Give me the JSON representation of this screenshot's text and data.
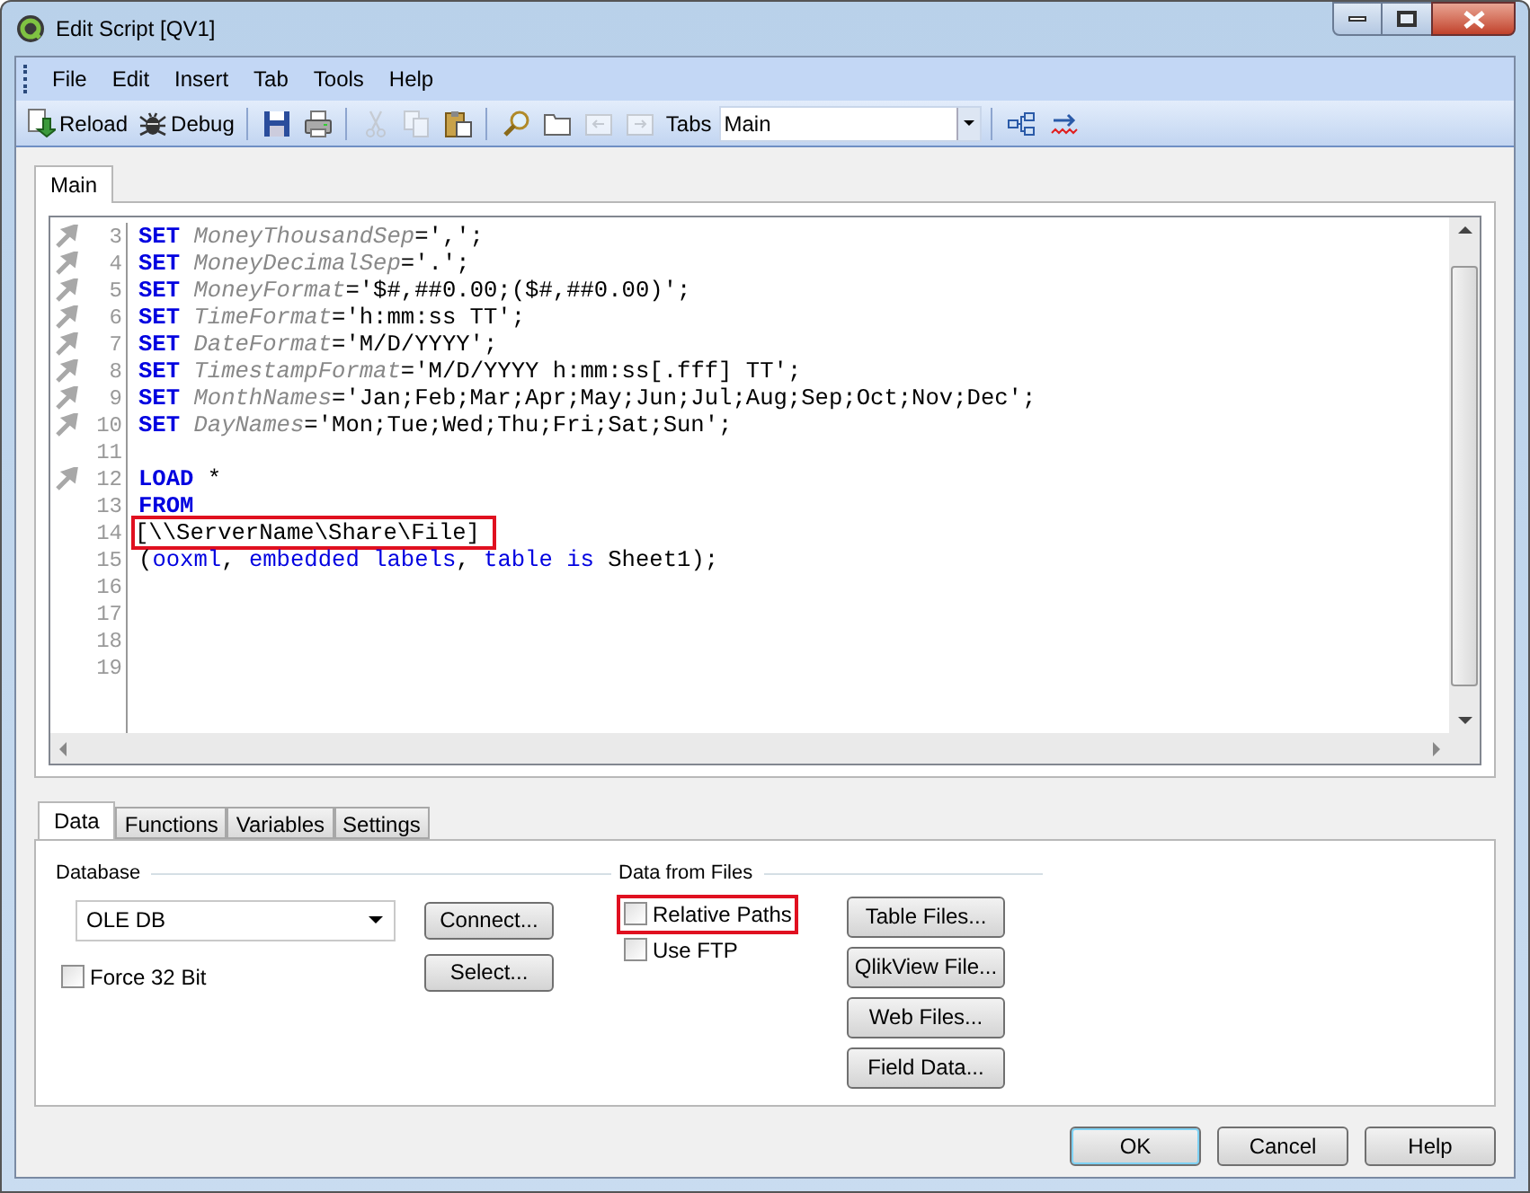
{
  "window": {
    "title": "Edit Script [QV1]"
  },
  "menu": [
    "File",
    "Edit",
    "Insert",
    "Tab",
    "Tools",
    "Help"
  ],
  "toolbar": {
    "buttons": [
      {
        "label": "Reload"
      },
      {
        "label": "Debug"
      }
    ],
    "icon_tools": [
      {
        "disabled": false
      },
      {
        "disabled": false
      },
      {
        "disabled": true
      },
      {
        "disabled": true
      },
      {
        "disabled": false
      },
      {
        "disabled": false
      },
      {
        "disabled": false
      },
      {
        "disabled": true
      },
      {
        "disabled": true
      }
    ],
    "tabs_label": "Tabs",
    "tabs_value": "Main"
  },
  "script_tabs": [
    {
      "label": "Main",
      "selected": true
    }
  ],
  "editor": {
    "lines": [
      {
        "number": "3",
        "marker": true,
        "highlighted": false,
        "tokens": [
          {
            "kind": "keyword",
            "text": "SET "
          },
          {
            "kind": "variable",
            "text": "MoneyThousandSep"
          },
          {
            "kind": "plain",
            "text": "=',';"
          }
        ]
      },
      {
        "number": "4",
        "marker": true,
        "highlighted": false,
        "tokens": [
          {
            "kind": "keyword",
            "text": "SET "
          },
          {
            "kind": "variable",
            "text": "MoneyDecimalSep"
          },
          {
            "kind": "plain",
            "text": "='.';"
          }
        ]
      },
      {
        "number": "5",
        "marker": true,
        "highlighted": false,
        "tokens": [
          {
            "kind": "keyword",
            "text": "SET "
          },
          {
            "kind": "variable",
            "text": "MoneyFormat"
          },
          {
            "kind": "plain",
            "text": "='$#,##0.00;($#,##0.00)';"
          }
        ]
      },
      {
        "number": "6",
        "marker": true,
        "highlighted": false,
        "tokens": [
          {
            "kind": "keyword",
            "text": "SET "
          },
          {
            "kind": "variable",
            "text": "TimeFormat"
          },
          {
            "kind": "plain",
            "text": "='h:mm:ss TT';"
          }
        ]
      },
      {
        "number": "7",
        "marker": true,
        "highlighted": false,
        "tokens": [
          {
            "kind": "keyword",
            "text": "SET "
          },
          {
            "kind": "variable",
            "text": "DateFormat"
          },
          {
            "kind": "plain",
            "text": "='M/D/YYYY';"
          }
        ]
      },
      {
        "number": "8",
        "marker": true,
        "highlighted": false,
        "tokens": [
          {
            "kind": "keyword",
            "text": "SET "
          },
          {
            "kind": "variable",
            "text": "TimestampFormat"
          },
          {
            "kind": "plain",
            "text": "='M/D/YYYY h:mm:ss[.fff] TT';"
          }
        ]
      },
      {
        "number": "9",
        "marker": true,
        "highlighted": false,
        "tokens": [
          {
            "kind": "keyword",
            "text": "SET "
          },
          {
            "kind": "variable",
            "text": "MonthNames"
          },
          {
            "kind": "plain",
            "text": "='Jan;Feb;Mar;Apr;May;Jun;Jul;Aug;Sep;Oct;Nov;Dec';"
          }
        ]
      },
      {
        "number": "10",
        "marker": true,
        "highlighted": false,
        "tokens": [
          {
            "kind": "keyword",
            "text": "SET "
          },
          {
            "kind": "variable",
            "text": "DayNames"
          },
          {
            "kind": "plain",
            "text": "='Mon;Tue;Wed;Thu;Fri;Sat;Sun';"
          }
        ]
      },
      {
        "number": "11",
        "marker": false,
        "highlighted": false
      },
      {
        "number": "12",
        "marker": true,
        "highlighted": false,
        "tokens": [
          {
            "kind": "keyword",
            "text": "LOAD"
          },
          {
            "kind": "plain",
            "text": " *"
          }
        ]
      },
      {
        "number": "13",
        "marker": false,
        "highlighted": false,
        "tokens": [
          {
            "kind": "keyword",
            "text": "FROM"
          }
        ]
      },
      {
        "number": "14",
        "marker": false,
        "highlighted": true,
        "tokens": [
          {
            "kind": "plain",
            "text": "[\\\\ServerName\\Share\\File]"
          }
        ]
      },
      {
        "number": "15",
        "marker": false,
        "highlighted": false,
        "tokens": [
          {
            "kind": "plain",
            "text": "("
          },
          {
            "kind": "keyword",
            "text": "ooxml"
          },
          {
            "kind": "plain",
            "text": ", "
          },
          {
            "kind": "keyword",
            "text": "embedded labels"
          },
          {
            "kind": "plain",
            "text": ", "
          },
          {
            "kind": "keyword",
            "text": "table is"
          },
          {
            "kind": "plain",
            "text": " Sheet1);"
          }
        ]
      },
      {
        "number": "16",
        "marker": false,
        "highlighted": false
      },
      {
        "number": "17",
        "marker": false,
        "highlighted": false
      },
      {
        "number": "18",
        "marker": false,
        "highlighted": false
      },
      {
        "number": "19",
        "marker": false,
        "highlighted": false
      }
    ]
  },
  "panel_tabs": [
    {
      "label": "Data",
      "selected": true
    },
    {
      "label": "Functions",
      "selected": false
    },
    {
      "label": "Variables",
      "selected": false
    },
    {
      "label": "Settings",
      "selected": false
    }
  ],
  "database": {
    "title": "Database",
    "value": "OLE DB",
    "checkbox": {
      "label": "Force 32 Bit",
      "checked": false,
      "highlighted": false
    },
    "buttons": [
      "Connect...",
      "Select..."
    ]
  },
  "data_from_files": {
    "title": "Data from Files",
    "checkboxes": [
      {
        "label": "Relative Paths",
        "checked": false,
        "highlighted": true
      },
      {
        "label": "Use FTP",
        "checked": false,
        "highlighted": false
      }
    ],
    "buttons": [
      "Table Files...",
      "QlikView File...",
      "Web Files...",
      "Field Data..."
    ]
  },
  "dialog_buttons": [
    {
      "label": "OK",
      "default": true
    },
    {
      "label": "Cancel",
      "default": false
    },
    {
      "label": "Help",
      "default": false
    }
  ]
}
